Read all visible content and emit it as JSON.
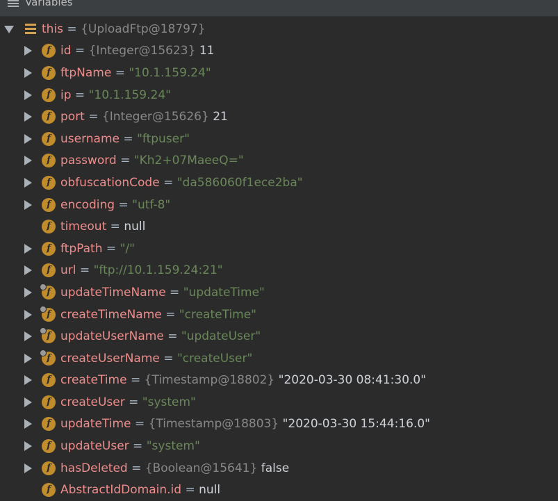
{
  "header": {
    "title": "Variables"
  },
  "root": {
    "name": "this",
    "ref": "{UploadFtp@18797}"
  },
  "fields": [
    {
      "name": "id",
      "ref": "{Integer@15623}",
      "value": "11",
      "kind": "plain",
      "expandable": true,
      "lock": false
    },
    {
      "name": "ftpName",
      "ref": "",
      "value": "\"10.1.159.24\"",
      "kind": "str",
      "expandable": true,
      "lock": false
    },
    {
      "name": "ip",
      "ref": "",
      "value": "\"10.1.159.24\"",
      "kind": "str",
      "expandable": true,
      "lock": false
    },
    {
      "name": "port",
      "ref": "{Integer@15626}",
      "value": "21",
      "kind": "plain",
      "expandable": true,
      "lock": false
    },
    {
      "name": "username",
      "ref": "",
      "value": "\"ftpuser\"",
      "kind": "str",
      "expandable": true,
      "lock": false
    },
    {
      "name": "password",
      "ref": "",
      "value": "\"Kh2+07MaeeQ=\"",
      "kind": "str",
      "expandable": true,
      "lock": false
    },
    {
      "name": "obfuscationCode",
      "ref": "",
      "value": "\"da586060f1ece2ba\"",
      "kind": "str",
      "expandable": true,
      "lock": false
    },
    {
      "name": "encoding",
      "ref": "",
      "value": "\"utf-8\"",
      "kind": "str",
      "expandable": true,
      "lock": false
    },
    {
      "name": "timeout",
      "ref": "",
      "value": "null",
      "kind": "plain",
      "expandable": false,
      "lock": false
    },
    {
      "name": "ftpPath",
      "ref": "",
      "value": "\"/\"",
      "kind": "str",
      "expandable": true,
      "lock": false
    },
    {
      "name": "url",
      "ref": "",
      "value": "\"ftp://10.1.159.24:21\"",
      "kind": "str",
      "expandable": true,
      "lock": false
    },
    {
      "name": "updateTimeName",
      "ref": "",
      "value": "\"updateTime\"",
      "kind": "str",
      "expandable": true,
      "lock": true
    },
    {
      "name": "createTimeName",
      "ref": "",
      "value": "\"createTime\"",
      "kind": "str",
      "expandable": true,
      "lock": true
    },
    {
      "name": "updateUserName",
      "ref": "",
      "value": "\"updateUser\"",
      "kind": "str",
      "expandable": true,
      "lock": true
    },
    {
      "name": "createUserName",
      "ref": "",
      "value": "\"createUser\"",
      "kind": "str",
      "expandable": true,
      "lock": true
    },
    {
      "name": "createTime",
      "ref": "{Timestamp@18802}",
      "value": "\"2020-03-30 08:41:30.0\"",
      "kind": "plain",
      "expandable": true,
      "lock": false
    },
    {
      "name": "createUser",
      "ref": "",
      "value": "\"system\"",
      "kind": "str",
      "expandable": true,
      "lock": false
    },
    {
      "name": "updateTime",
      "ref": "{Timestamp@18803}",
      "value": "\"2020-03-30 15:44:16.0\"",
      "kind": "plain",
      "expandable": true,
      "lock": false
    },
    {
      "name": "updateUser",
      "ref": "",
      "value": "\"system\"",
      "kind": "str",
      "expandable": true,
      "lock": false
    },
    {
      "name": "hasDeleted",
      "ref": "{Boolean@15641}",
      "value": "false",
      "kind": "plain",
      "expandable": true,
      "lock": false
    },
    {
      "name": "AbstractIdDomain.id",
      "ref": "",
      "value": "null",
      "kind": "plain",
      "expandable": false,
      "lock": false
    }
  ],
  "colors": {
    "background": "#2b2b2b",
    "field_name": "#ee8c8c",
    "string_value": "#6a8759",
    "reference": "#888888",
    "field_icon": "#c08c2c"
  },
  "icons": {
    "header": "menu-lines-icon",
    "root": "object-stack-icon",
    "field": "field-f-icon",
    "expand": "triangle-right-icon",
    "collapse": "triangle-down-icon"
  }
}
